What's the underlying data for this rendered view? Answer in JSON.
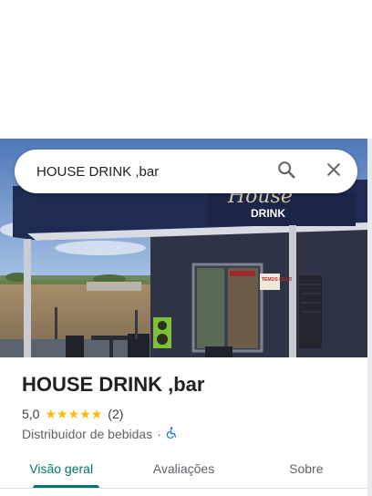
{
  "search": {
    "query": "HOUSE DRINK ,bar",
    "search_icon": "search-icon",
    "close_icon": "close-icon"
  },
  "photo": {
    "sign_text": "DRINK",
    "sign_script": "House",
    "poster_text": "TEMOS GELO"
  },
  "place": {
    "name": "HOUSE DRINK ,bar",
    "rating": "5,0",
    "stars": 5,
    "review_count": "(2)",
    "category": "Distribuidor de bebidas",
    "separator": "·",
    "accessibility_icon": "wheelchair-icon"
  },
  "tabs": [
    {
      "label": "Visão geral",
      "active": true
    },
    {
      "label": "Avaliações",
      "active": false
    },
    {
      "label": "Sobre",
      "active": false
    }
  ],
  "colors": {
    "accent": "#00756c",
    "star": "#fbbc04",
    "accessibility": "#1a73e8"
  }
}
